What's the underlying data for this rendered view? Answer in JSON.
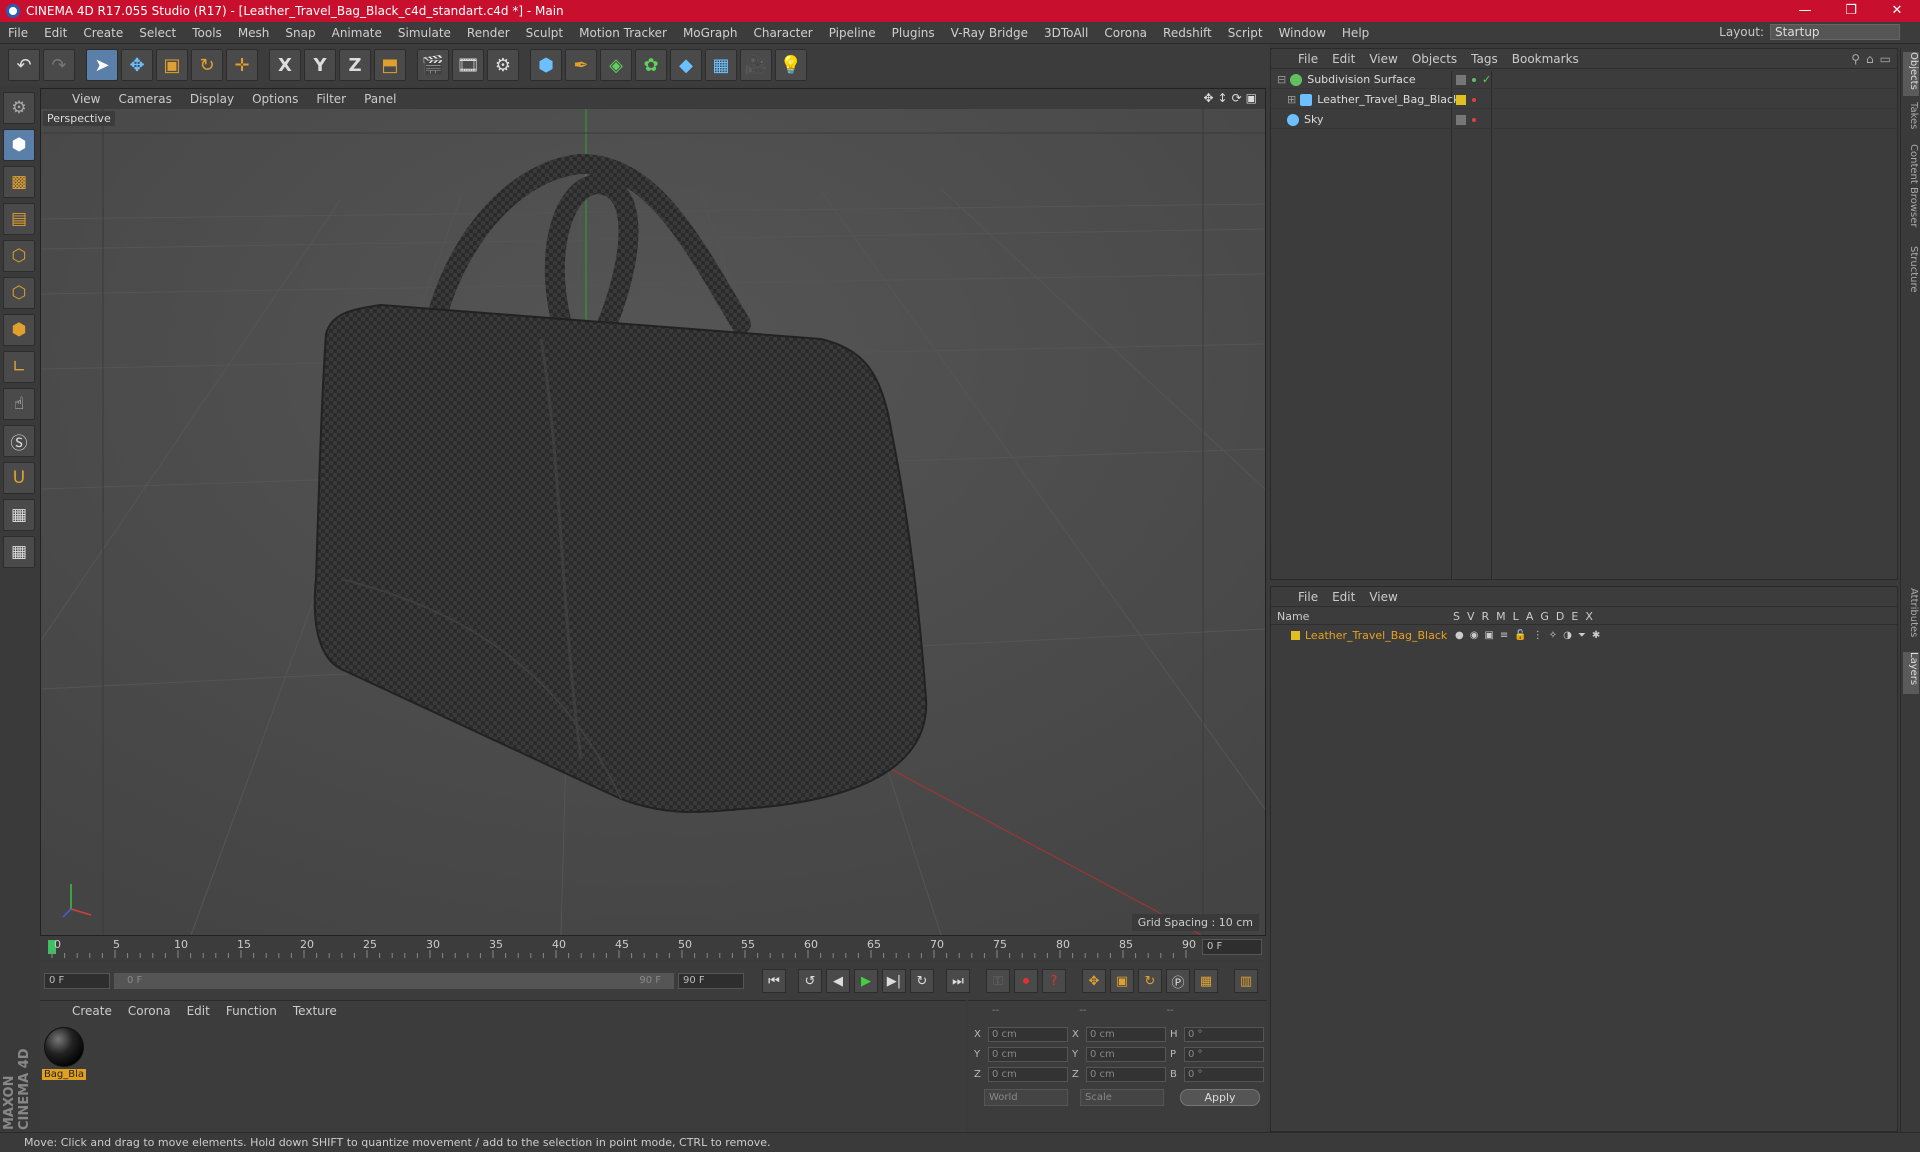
{
  "window": {
    "title": "CINEMA 4D R17.055 Studio (R17) - [Leather_Travel_Bag_Black_c4d_standart.c4d *] - Main",
    "controls": [
      "—",
      "❐",
      "✕"
    ]
  },
  "menubar": {
    "items": [
      "File",
      "Edit",
      "Create",
      "Select",
      "Tools",
      "Mesh",
      "Snap",
      "Animate",
      "Simulate",
      "Render",
      "Sculpt",
      "Motion Tracker",
      "MoGraph",
      "Character",
      "Pipeline",
      "Plugins",
      "V-Ray Bridge",
      "3DToAll",
      "Corona",
      "Redshift",
      "Script",
      "Window",
      "Help"
    ],
    "layout_label": "Layout:",
    "layout_value": "Startup"
  },
  "toolbar": {
    "axis_x": "X",
    "axis_y": "Y",
    "axis_z": "Z"
  },
  "viewport": {
    "menu": [
      "View",
      "Cameras",
      "Display",
      "Options",
      "Filter",
      "Panel"
    ],
    "label": "Perspective",
    "grid_spacing": "Grid Spacing : 10 cm"
  },
  "timeline": {
    "ticks": [
      "0",
      "5",
      "10",
      "15",
      "20",
      "25",
      "30",
      "35",
      "40",
      "45",
      "50",
      "55",
      "60",
      "65",
      "70",
      "75",
      "80",
      "85",
      "90"
    ],
    "current_frame": "0 F",
    "start_field": "0 F",
    "range_start": "0 F",
    "range_end": "90 F",
    "end_field": "90 F"
  },
  "material_panel": {
    "menu": [
      "Create",
      "Corona",
      "Edit",
      "Function",
      "Texture"
    ],
    "material_name": "Bag_Bla"
  },
  "coords": {
    "header": [
      "--",
      "--",
      "--"
    ],
    "rows": [
      {
        "a": "X",
        "av": "0 cm",
        "b": "X",
        "bv": "0 cm",
        "c": "H",
        "cv": "0 °"
      },
      {
        "a": "Y",
        "av": "0 cm",
        "b": "Y",
        "bv": "0 cm",
        "c": "P",
        "cv": "0 °"
      },
      {
        "a": "Z",
        "av": "0 cm",
        "b": "Z",
        "bv": "0 cm",
        "c": "B",
        "cv": "0 °"
      }
    ],
    "mode1": "World",
    "mode2": "Scale",
    "apply": "Apply"
  },
  "object_manager": {
    "menu": [
      "File",
      "Edit",
      "View",
      "Objects",
      "Tags",
      "Bookmarks"
    ],
    "objects": [
      {
        "name": "Subdivision Surface",
        "color": "#60c060"
      },
      {
        "name": "Leather_Travel_Bag_Black",
        "color": "#6cc0ff"
      },
      {
        "name": "Sky",
        "color": "#6cc0ff"
      }
    ]
  },
  "layer_manager": {
    "menu": [
      "File",
      "Edit",
      "View"
    ],
    "name_col": "Name",
    "cols": [
      "S",
      "V",
      "R",
      "M",
      "L",
      "A",
      "G",
      "D",
      "E",
      "X"
    ],
    "layer_name": "Leather_Travel_Bag_Black"
  },
  "side_tabs": [
    "Objects",
    "Takes",
    "Content Browser",
    "Structure",
    "Attributes",
    "Layers"
  ],
  "status": "Move: Click and drag to move elements. Hold down SHIFT to quantize movement / add to the selection in point mode, CTRL to remove.",
  "branding": "MAXON CINEMA 4D"
}
